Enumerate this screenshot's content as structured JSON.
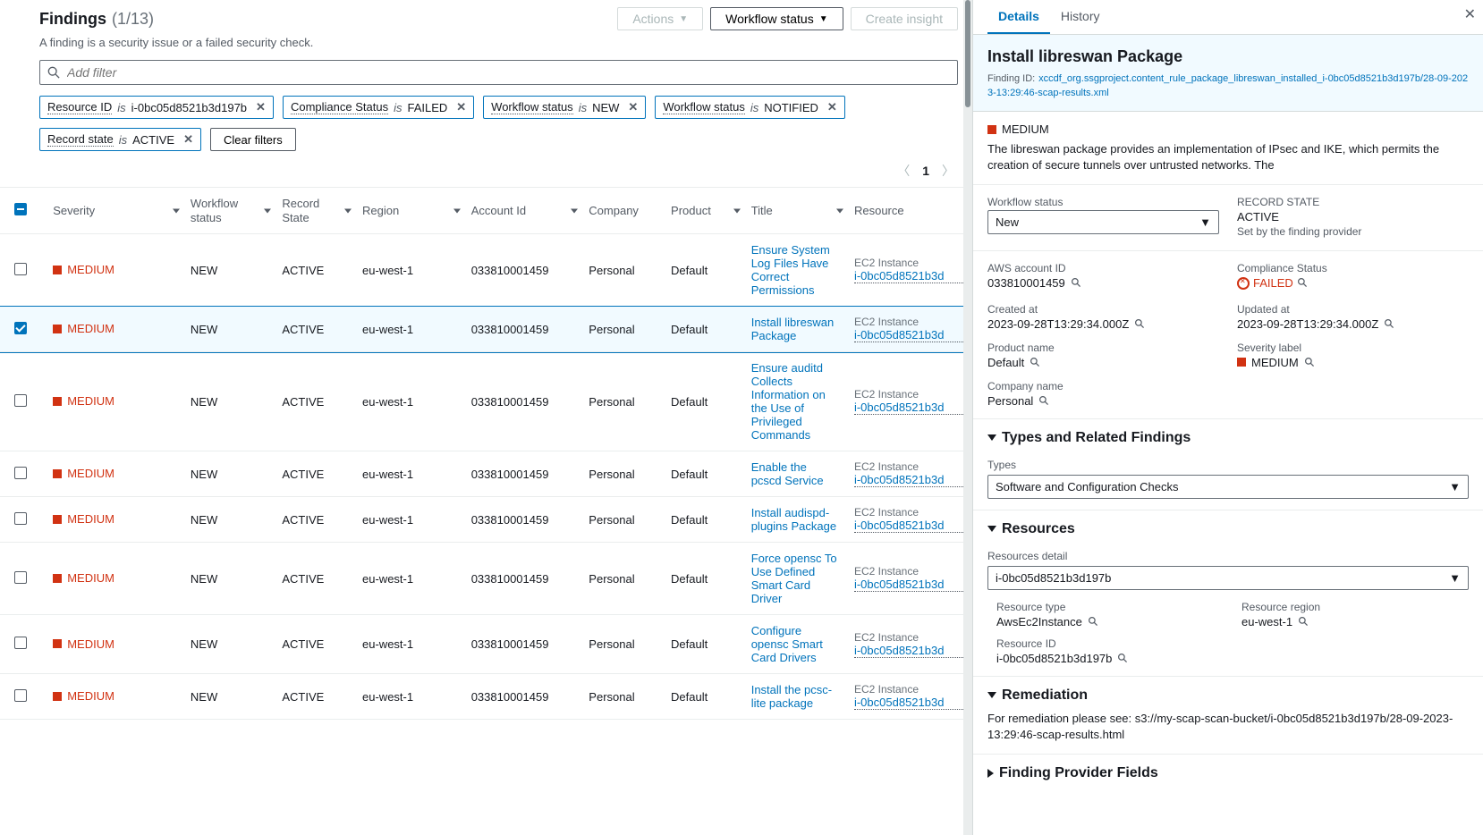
{
  "header": {
    "title": "Findings",
    "count": "(1/13)",
    "subtitle": "A finding is a security issue or a failed security check.",
    "actions_label": "Actions",
    "workflow_label": "Workflow status",
    "create_insight_label": "Create insight"
  },
  "filter": {
    "placeholder": "Add filter",
    "clear_label": "Clear filters",
    "chips": [
      {
        "field": "Resource ID",
        "op": "is",
        "val": "i-0bc05d8521b3d197b"
      },
      {
        "field": "Compliance Status",
        "op": "is",
        "val": "FAILED"
      },
      {
        "field": "Workflow status",
        "op": "is",
        "val": "NEW"
      },
      {
        "field": "Workflow status",
        "op": "is",
        "val": "NOTIFIED"
      },
      {
        "field": "Record state",
        "op": "is",
        "val": "ACTIVE"
      }
    ]
  },
  "pagination": {
    "page": "1"
  },
  "columns": {
    "severity": "Severity",
    "workflow": "Workflow status",
    "record": "Record State",
    "region": "Region",
    "account": "Account Id",
    "company": "Company",
    "product": "Product",
    "title": "Title",
    "resource": "Resource"
  },
  "rows": [
    {
      "severity": "MEDIUM",
      "workflow": "NEW",
      "record": "ACTIVE",
      "region": "eu-west-1",
      "account": "033810001459",
      "company": "Personal",
      "product": "Default",
      "title": "Ensure System Log Files Have Correct Permissions",
      "res_type": "EC2 Instance",
      "res_id": "i-0bc05d8521b3d",
      "selected": false
    },
    {
      "severity": "MEDIUM",
      "workflow": "NEW",
      "record": "ACTIVE",
      "region": "eu-west-1",
      "account": "033810001459",
      "company": "Personal",
      "product": "Default",
      "title": "Install libreswan Package",
      "res_type": "EC2 Instance",
      "res_id": "i-0bc05d8521b3d",
      "selected": true
    },
    {
      "severity": "MEDIUM",
      "workflow": "NEW",
      "record": "ACTIVE",
      "region": "eu-west-1",
      "account": "033810001459",
      "company": "Personal",
      "product": "Default",
      "title": "Ensure auditd Collects Information on the Use of Privileged Commands",
      "res_type": "EC2 Instance",
      "res_id": "i-0bc05d8521b3d",
      "selected": false
    },
    {
      "severity": "MEDIUM",
      "workflow": "NEW",
      "record": "ACTIVE",
      "region": "eu-west-1",
      "account": "033810001459",
      "company": "Personal",
      "product": "Default",
      "title": "Enable the pcscd Service",
      "res_type": "EC2 Instance",
      "res_id": "i-0bc05d8521b3d",
      "selected": false
    },
    {
      "severity": "MEDIUM",
      "workflow": "NEW",
      "record": "ACTIVE",
      "region": "eu-west-1",
      "account": "033810001459",
      "company": "Personal",
      "product": "Default",
      "title": "Install audispd-plugins Package",
      "res_type": "EC2 Instance",
      "res_id": "i-0bc05d8521b3d",
      "selected": false
    },
    {
      "severity": "MEDIUM",
      "workflow": "NEW",
      "record": "ACTIVE",
      "region": "eu-west-1",
      "account": "033810001459",
      "company": "Personal",
      "product": "Default",
      "title": "Force opensc To Use Defined Smart Card Driver",
      "res_type": "EC2 Instance",
      "res_id": "i-0bc05d8521b3d",
      "selected": false
    },
    {
      "severity": "MEDIUM",
      "workflow": "NEW",
      "record": "ACTIVE",
      "region": "eu-west-1",
      "account": "033810001459",
      "company": "Personal",
      "product": "Default",
      "title": "Configure opensc Smart Card Drivers",
      "res_type": "EC2 Instance",
      "res_id": "i-0bc05d8521b3d",
      "selected": false
    },
    {
      "severity": "MEDIUM",
      "workflow": "NEW",
      "record": "ACTIVE",
      "region": "eu-west-1",
      "account": "033810001459",
      "company": "Personal",
      "product": "Default",
      "title": "Install the pcsc-lite package",
      "res_type": "EC2 Instance",
      "res_id": "i-0bc05d8521b3d",
      "selected": false
    }
  ],
  "detail": {
    "tabs": {
      "details": "Details",
      "history": "History"
    },
    "title": "Install libreswan Package",
    "finding_id_label": "Finding ID:",
    "finding_id": "xccdf_org.ssgproject.content_rule_package_libreswan_installed_i-0bc05d8521b3d197b/28-09-2023-13:29:46-scap-results.xml",
    "severity": "MEDIUM",
    "description": "The libreswan package provides an implementation of IPsec and IKE, which permits the creation of secure tunnels over untrusted networks. The",
    "workflow_label": "Workflow status",
    "workflow_value": "New",
    "record_state_label": "RECORD STATE",
    "record_state_value": "ACTIVE",
    "record_state_note": "Set by the finding provider",
    "aws_account_label": "AWS account ID",
    "aws_account": "033810001459",
    "compliance_label": "Compliance Status",
    "compliance_value": "FAILED",
    "created_label": "Created at",
    "created": "2023-09-28T13:29:34.000Z",
    "updated_label": "Updated at",
    "updated": "2023-09-28T13:29:34.000Z",
    "product_label": "Product name",
    "product": "Default",
    "sev_label": "Severity label",
    "sev_value": "MEDIUM",
    "company_label": "Company name",
    "company": "Personal",
    "types_heading": "Types and Related Findings",
    "types_label": "Types",
    "types_value": "Software and Configuration Checks",
    "resources_heading": "Resources",
    "resources_detail_label": "Resources detail",
    "resources_detail_value": "i-0bc05d8521b3d197b",
    "resource_type_label": "Resource type",
    "resource_type": "AwsEc2Instance",
    "resource_region_label": "Resource region",
    "resource_region": "eu-west-1",
    "resource_id_label": "Resource ID",
    "resource_id": "i-0bc05d8521b3d197b",
    "remediation_heading": "Remediation",
    "remediation_text": "For remediation please see: s3://my-scap-scan-bucket/i-0bc05d8521b3d197b/28-09-2023-13:29:46-scap-results.html",
    "provider_heading": "Finding Provider Fields"
  }
}
